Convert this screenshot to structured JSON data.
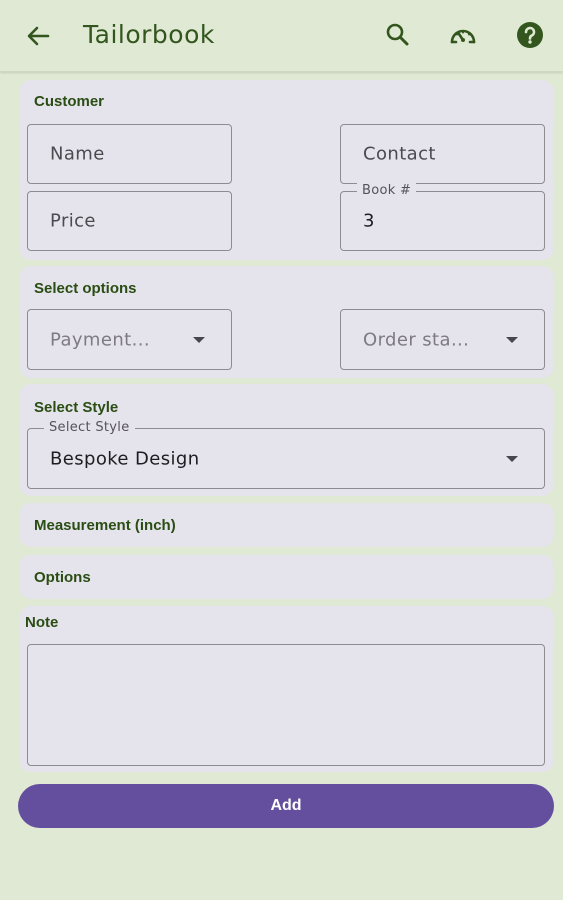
{
  "app": {
    "title": "Tailorbook"
  },
  "colors": {
    "background": "#e0e9d4",
    "accent": "#644f9e",
    "heading": "#2a4d14",
    "card": "#e5e3eb"
  },
  "icons": {
    "back": "arrow-left-icon",
    "search": "search-icon",
    "meter": "speedometer-icon",
    "help": "help-circle-icon"
  },
  "customer": {
    "heading": "Customer",
    "name_placeholder": "Name",
    "contact_placeholder": "Contact",
    "price_placeholder": "Price",
    "book_label": "Book #",
    "book_value": "3"
  },
  "options": {
    "heading": "Select options",
    "payment_placeholder": "Payment...",
    "order_status_placeholder": "Order sta..."
  },
  "style": {
    "heading": "Select Style",
    "field_label": "Select Style",
    "selected": "Bespoke Design"
  },
  "measurement": {
    "heading": "Measurement (inch)"
  },
  "extra_options": {
    "heading": "Options"
  },
  "note": {
    "heading": "Note",
    "value": ""
  },
  "actions": {
    "add_label": "Add"
  }
}
